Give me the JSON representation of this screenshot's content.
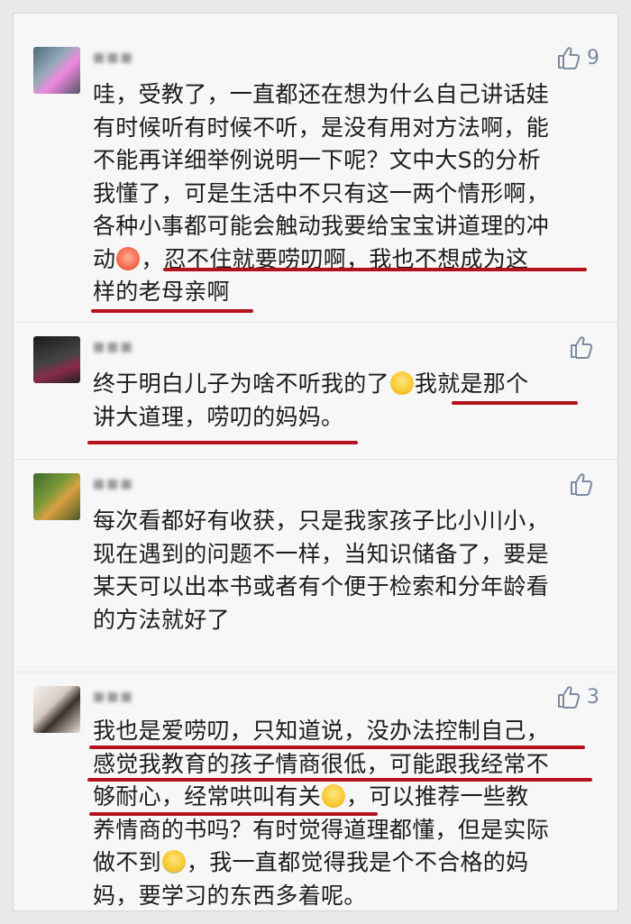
{
  "comments": [
    {
      "nickname": "■■■",
      "likes": "9",
      "lines": [
        "哇，受教了，一直都还在想为什么自己讲话娃",
        "有时候听有时候不听，是没有用对方法啊，能",
        "不能再详细举例说明一下呢？文中大S的分析",
        "我懂了，可是生活中不只有这一两个情形啊，",
        "各种小事都可能会触动我要给宝宝讲道理的冲",
        "动",
        "，忍不住就要唠叨啊，我也不想成为这",
        "样的老母亲啊"
      ]
    },
    {
      "nickname": "■■■",
      "likes": "",
      "lines": [
        "终于明白儿子为啥不听我的了",
        "我就是那个",
        "讲大道理，唠叨的妈妈。"
      ]
    },
    {
      "nickname": "■■■",
      "likes": "",
      "lines": [
        "每次看都好有收获，只是我家孩子比小川小，",
        "现在遇到的问题不一样，当知识储备了，要是",
        "某天可以出本书或者有个便于检索和分年龄看",
        "的方法就好了"
      ]
    },
    {
      "nickname": "■■■",
      "likes": "3",
      "lines": [
        "我也是爱唠叨，只知道说，没办法控制自己，",
        "感觉我教育的孩子情商很低，可能跟我经常不",
        "够耐心，经常哄叫有关",
        "，可以推荐一些教",
        "养情商的书吗？有时觉得道理都懂，但是实际",
        "做不到",
        "，我一直都觉得我是个不合格的妈",
        "妈，要学习的东西多着呢。"
      ]
    }
  ],
  "icons": {
    "like": "thumbs-up-icon",
    "emoji_1": "flushed-face-icon",
    "emoji_2": "grinning-face-icon",
    "emoji_3": "frowning-face-icon",
    "emoji_4": "crying-face-icon"
  },
  "colors": {
    "underline": "#b3121c",
    "like": "#7d8aa0"
  }
}
